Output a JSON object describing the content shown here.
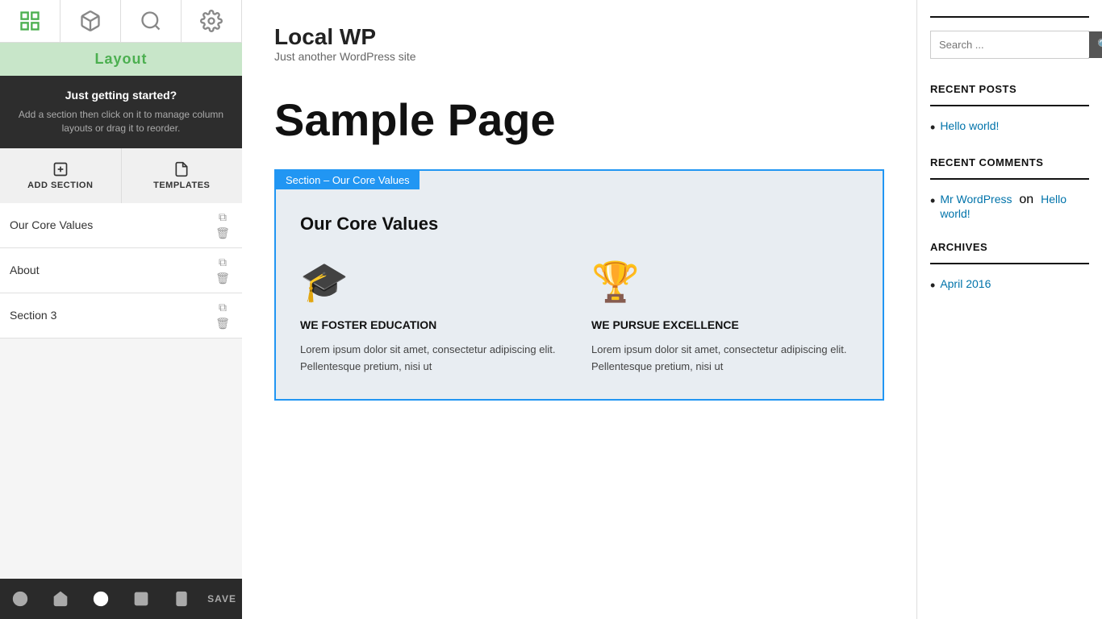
{
  "sidebar": {
    "layout_label": "Layout",
    "getting_started_title": "Just getting started?",
    "getting_started_desc": "Add a section then click on it to manage column layouts or drag it to reorder.",
    "add_section_label": "ADD SECTION",
    "templates_label": "TEMPLATES",
    "sections": [
      {
        "id": 1,
        "label": "Our Core Values"
      },
      {
        "id": 2,
        "label": "About"
      },
      {
        "id": 3,
        "label": "Section 3"
      }
    ],
    "save_label": "SAVE"
  },
  "site": {
    "title": "Local WP",
    "tagline": "Just another WordPress site"
  },
  "page": {
    "title": "Sample Page"
  },
  "preview": {
    "section_label": "Section – Our Core Values",
    "heading": "Our Core Values",
    "columns": [
      {
        "icon": "🎓",
        "title": "WE FOSTER EDUCATION",
        "text": "Lorem ipsum dolor sit amet, consectetur adipiscing elit. Pellentesque pretium, nisi ut"
      },
      {
        "icon": "🏆",
        "title": "WE PURSUE EXCELLENCE",
        "text": "Lorem ipsum dolor sit amet, consectetur adipiscing elit. Pellentesque pretium, nisi ut"
      }
    ]
  },
  "right_sidebar": {
    "search_placeholder": "Search ...",
    "search_label": "Search",
    "recent_posts_title": "RECENT POSTS",
    "recent_posts": [
      {
        "label": "Hello world!",
        "url": "#"
      }
    ],
    "recent_comments_title": "RECENT COMMENTS",
    "recent_comments": [
      {
        "author": "Mr WordPress",
        "author_url": "#",
        "text": "on",
        "post": "Hello world!",
        "post_url": "#"
      }
    ],
    "archives_title": "ARCHIVES",
    "archives": [
      {
        "label": "April 2016",
        "url": "#"
      }
    ]
  }
}
